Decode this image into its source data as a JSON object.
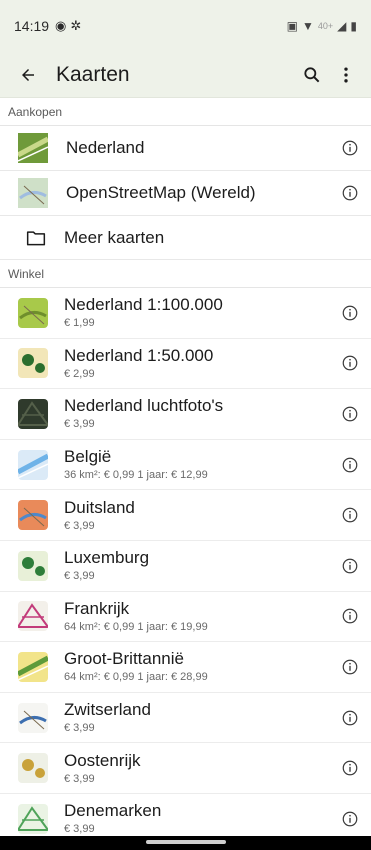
{
  "status": {
    "time": "14:19",
    "network": "40+"
  },
  "app_bar": {
    "title": "Kaarten"
  },
  "purchases": {
    "header": "Aankopen",
    "items": [
      {
        "label": "Nederland",
        "thumb_colors": [
          "#6f9a3a",
          "#c9d98a"
        ]
      },
      {
        "label": "OpenStreetMap (Wereld)",
        "thumb_colors": [
          "#cfe0c8",
          "#9fbce0"
        ]
      }
    ],
    "more": "Meer kaarten"
  },
  "shop": {
    "header": "Winkel",
    "items": [
      {
        "name": "Nederland 1:100.000",
        "price": "€ 1,99",
        "thumb_colors": [
          "#a8c94a",
          "#6f8f2c"
        ]
      },
      {
        "name": "Nederland 1:50.000",
        "price": "€ 2,99",
        "thumb_colors": [
          "#f2e6b8",
          "#2b6e2e"
        ]
      },
      {
        "name": "Nederland luchtfoto's",
        "price": "€ 3,99",
        "thumb_colors": [
          "#2f3a2c",
          "#55604a"
        ]
      },
      {
        "name": "België",
        "price": "36 km²: € 0,99  1 jaar: € 12,99",
        "thumb_colors": [
          "#dbeaf7",
          "#6fb3e8"
        ]
      },
      {
        "name": "Duitsland",
        "price": "€ 3,99",
        "thumb_colors": [
          "#e98a5a",
          "#4e88c9"
        ]
      },
      {
        "name": "Luxemburg",
        "price": "€ 3,99",
        "thumb_colors": [
          "#e8f0d8",
          "#2e7d3a"
        ]
      },
      {
        "name": "Frankrijk",
        "price": "64 km²: € 0,99  1 jaar: € 19,99",
        "thumb_colors": [
          "#f3f0ea",
          "#c23b7a"
        ]
      },
      {
        "name": "Groot-Brittannië",
        "price": "64 km²: € 0,99  1 jaar: € 28,99",
        "thumb_colors": [
          "#f2e48a",
          "#5e9b3a"
        ]
      },
      {
        "name": "Zwitserland",
        "price": "€ 3,99",
        "thumb_colors": [
          "#f5f5f2",
          "#3d6fb0"
        ]
      },
      {
        "name": "Oostenrijk",
        "price": "€ 3,99",
        "thumb_colors": [
          "#eef0e6",
          "#c9a23a"
        ]
      },
      {
        "name": "Denemarken",
        "price": "€ 3,99",
        "thumb_colors": [
          "#eaf3e4",
          "#4fa35a"
        ]
      }
    ]
  },
  "colors": {
    "app_bar_bg": "#eef2e9",
    "text": "#1c1c1c",
    "secondary_text": "#6a6a6a"
  }
}
